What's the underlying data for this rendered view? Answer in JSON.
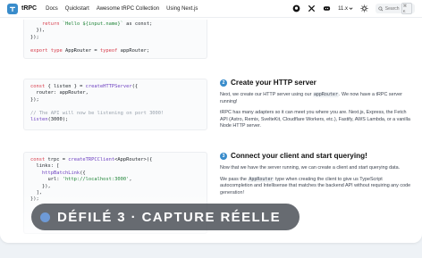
{
  "nav": {
    "brand": "tRPC",
    "links": [
      "Docs",
      "Quickstart",
      "Awesome tRPC Collection",
      "Using Next.js"
    ],
    "version": "11.x",
    "search_placeholder": "Search",
    "search_shortcut": "⌘ K"
  },
  "code1": {
    "line1_kw": "return",
    "line1_str": "`Hello ${input.name}`",
    "line1_rest": " as const;",
    "line2": "  }),",
    "line3": "});",
    "line4_kw": "export type",
    "line4_rest": " AppRouter = ",
    "line4_kw2": "typeof",
    "line4_end": " appRouter;"
  },
  "code2": {
    "l1a": "const",
    "l1b": " { listen } = ",
    "l1c": "createHTTPServer",
    "l1d": "({",
    "l2": "  router: appRouter,",
    "l3": "});",
    "l4": "// The API will now be listening on port 3000!",
    "l5a": "listen",
    "l5b": "(3000);"
  },
  "code3": {
    "l1a": "const",
    "l1b": " trpc = ",
    "l1c": "createTRPCClient",
    "l1d": "<AppRouter>({",
    "l2": "  links: [",
    "l3a": "    ",
    "l3b": "httpBatchLink",
    "l3c": "({",
    "l4a": "      url: ",
    "l4b": "'http://localhost:3000'",
    "l4c": ",",
    "l5": "    }),",
    "l6": "  ],",
    "l7": "});"
  },
  "section2": {
    "number": "2",
    "title": "Create your HTTP server",
    "p1_a": "Next, we create our HTTP server using our ",
    "p1_code": "appRouter",
    "p1_b": ". We now have a tRPC server running!",
    "p2": "tRPC has many adapters so it can meet you where you are. Next.js, Express, the Fetch API (Astro, Remix, SvelteKit, Cloudflare Workers, etc.), Fastify, AWS Lambda, or a vanilla Node HTTP server."
  },
  "section3": {
    "number": "3",
    "title": "Connect your client and start querying!",
    "p1": "Now that we have the server running, we can create a client and start querying data.",
    "p2_a": "We pass the ",
    "p2_code": "AppRouter",
    "p2_b": " type when creating the client to give us TypeScript autocompletion and Intellisense that matches the backend API without requiring any code generation!"
  },
  "overlay": {
    "label": "DÉFILÉ 3 · CAPTURE RÉELLE"
  },
  "colors": {
    "accent": "#398ccb",
    "banner": "#464a52"
  }
}
